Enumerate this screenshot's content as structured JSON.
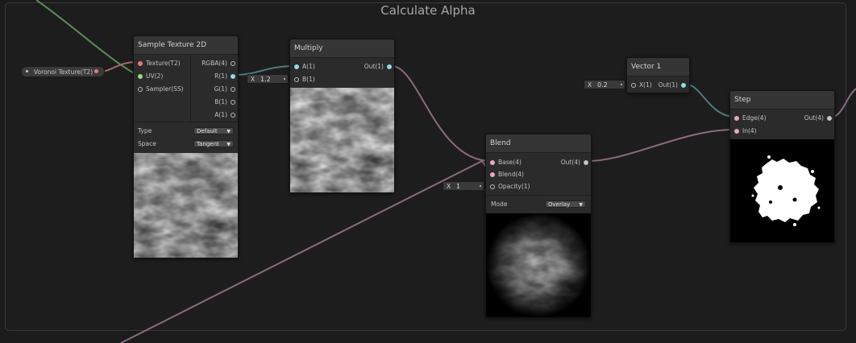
{
  "group": {
    "title": "Calculate Alpha"
  },
  "property_node": {
    "label": "Voronoi Texture(T2)"
  },
  "sample_texture": {
    "title": "Sample Texture 2D",
    "inputs": [
      "Texture(T2)",
      "UV(2)",
      "Sampler(SS)"
    ],
    "outputs": [
      "RGBA(4)",
      "R(1)",
      "G(1)",
      "B(1)",
      "A(1)"
    ],
    "type_label": "Type",
    "type_value": "Default",
    "space_label": "Space",
    "space_value": "Tangent"
  },
  "multiply": {
    "title": "Multiply",
    "inputs": [
      "A(1)",
      "B(1)"
    ],
    "output": "Out(1)",
    "b_axis": "X",
    "b_value": "1.2"
  },
  "vector1": {
    "title": "Vector 1",
    "input": "X(1)",
    "output": "Out(1)",
    "x_axis": "X",
    "x_value": "0.2"
  },
  "blend": {
    "title": "Blend",
    "inputs": [
      "Base(4)",
      "Blend(4)",
      "Opacity(1)"
    ],
    "output": "Out(4)",
    "opacity_axis": "X",
    "opacity_value": "1",
    "mode_label": "Mode",
    "mode_value": "Overlay"
  },
  "step": {
    "title": "Step",
    "inputs": [
      "Edge(4)",
      "In(4)"
    ],
    "output": "Out(4)"
  },
  "colors": {
    "background": "#1b1b1b",
    "node": "#2b2b2b",
    "wire_texture": "#a86a72",
    "wire_vector4": "#8a6a80",
    "wire_vector1": "#4e7a7e",
    "wire_uv": "#5b8a56",
    "port_vector4": "#e7a9c4",
    "port_vector1": "#8fdce6",
    "port_uv": "#9fd47c",
    "port_texture": "#e07b7b"
  }
}
